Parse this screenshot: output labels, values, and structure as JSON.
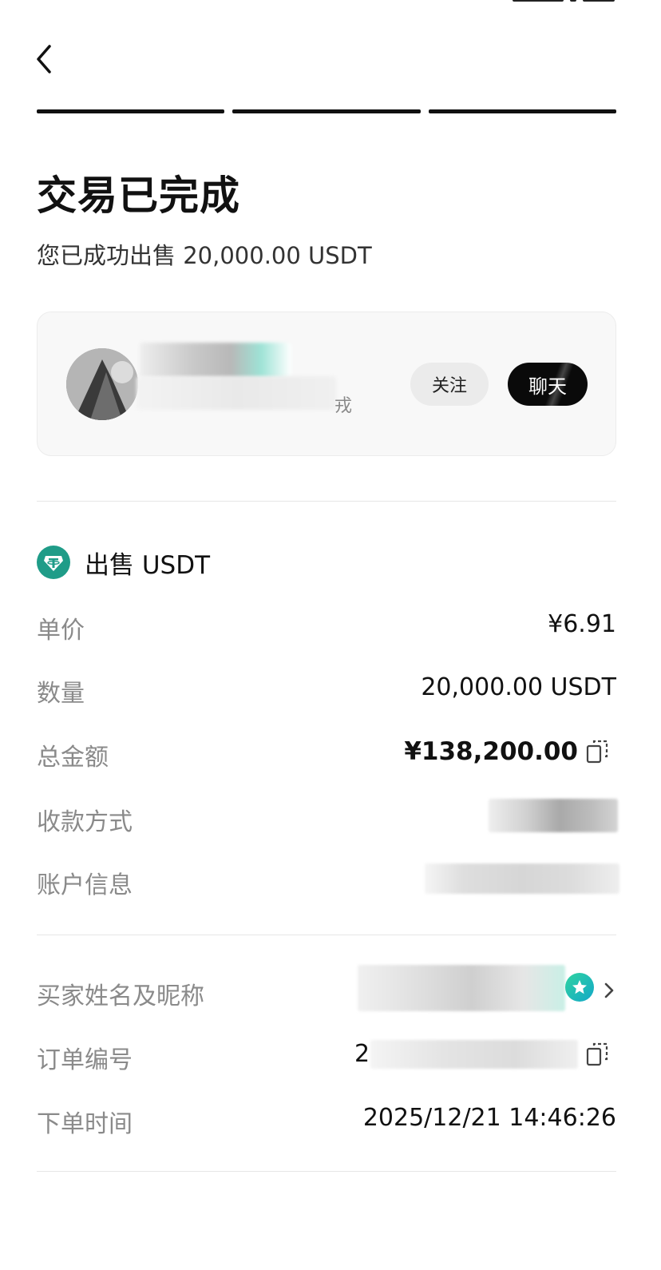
{
  "header": {
    "back_icon": "chevron-left-icon",
    "progress_steps": 3
  },
  "status": {
    "title": "交易已完成",
    "subtitle": "您已成功出售 20,000.00 USDT"
  },
  "counterparty": {
    "name_suffix": "戎",
    "follow_label": "关注",
    "chat_label": "聊天"
  },
  "order": {
    "section_title": "出售 USDT",
    "asset_icon": "tether-icon",
    "rows": {
      "unit_price": {
        "label": "单价",
        "value": "¥6.91"
      },
      "quantity": {
        "label": "数量",
        "value": "20,000.00 USDT"
      },
      "total": {
        "label": "总金额",
        "value": "¥138,200.00"
      },
      "payment_method": {
        "label": "收款方式"
      },
      "account_info": {
        "label": "账户信息"
      }
    }
  },
  "details": {
    "buyer": {
      "label": "买家姓名及昵称"
    },
    "order_no": {
      "label": "订单编号",
      "value_prefix": "2"
    },
    "order_time": {
      "label": "下单时间",
      "value": "2025/12/21 14:46:26"
    }
  },
  "colors": {
    "accent": "#1f9c88",
    "text_primary": "#111111",
    "text_secondary": "#8a8a8a",
    "card_bg": "#f8f8f8"
  }
}
